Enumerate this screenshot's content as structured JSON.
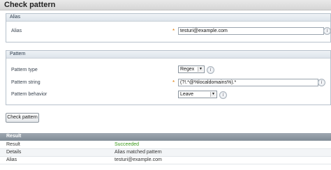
{
  "page": {
    "title": "Check pattern"
  },
  "alias_section": {
    "heading": "Alias",
    "alias_label": "Alias",
    "alias_value": "testuri@example.com",
    "required_mark": "*",
    "info_glyph": "i"
  },
  "pattern_section": {
    "heading": "Pattern",
    "type_label": "Pattern type",
    "type_value": "Regex",
    "string_label": "Pattern string",
    "string_value": "(?!.*@%localdomains%).*",
    "behavior_label": "Pattern behavior",
    "behavior_value": "Leave",
    "required_mark": "*",
    "info_glyph": "i",
    "select_arrow": "▼"
  },
  "actions": {
    "check_label": "Check pattern"
  },
  "result": {
    "heading": "Result",
    "rows": [
      {
        "key": "Result",
        "value": "Succeeded"
      },
      {
        "key": "Details",
        "value": "Alias matched pattern"
      },
      {
        "key": "Alias",
        "value": "testuri@example.com"
      }
    ],
    "success_color": "#3a9a1a"
  }
}
